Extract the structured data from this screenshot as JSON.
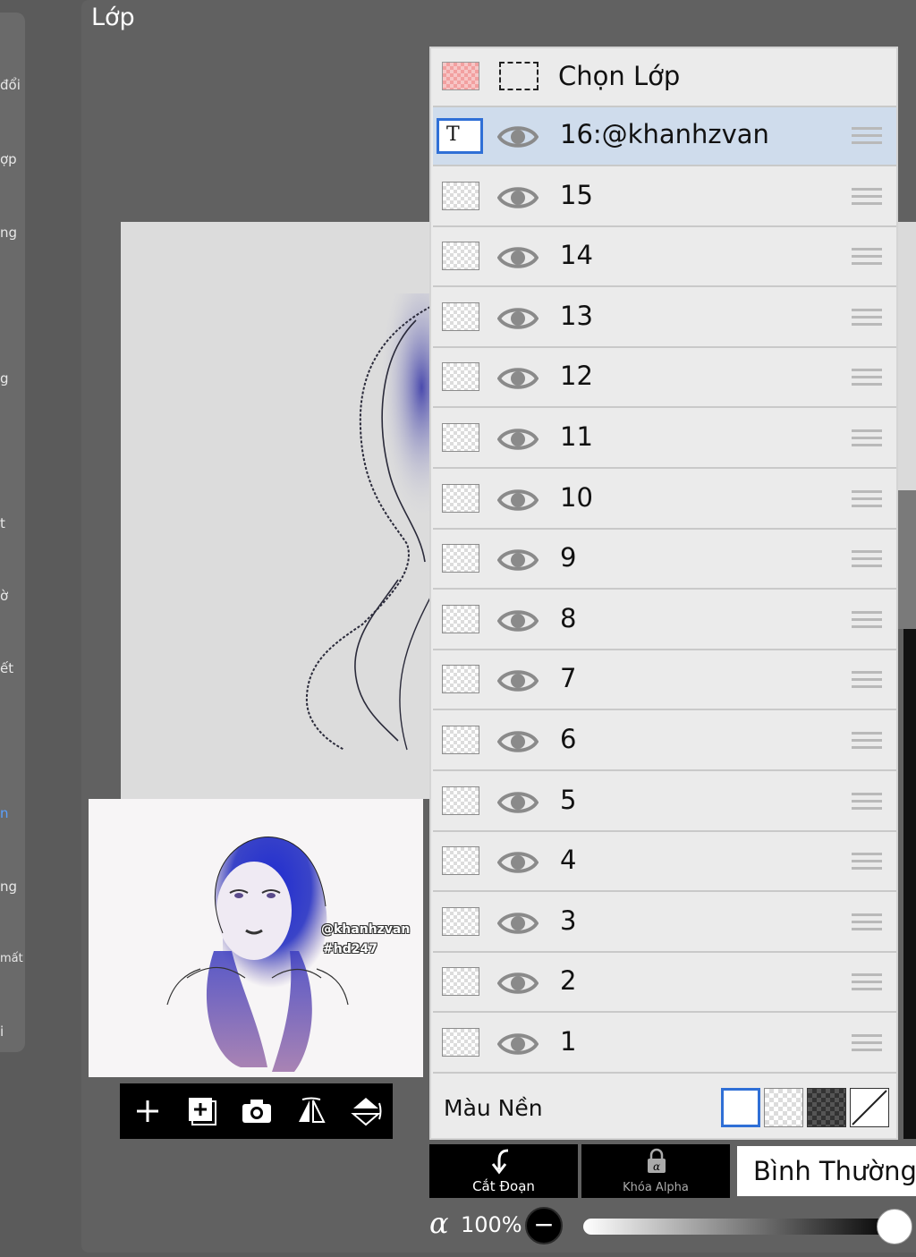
{
  "panel": {
    "title": "Lớp"
  },
  "side_menu": {
    "fragments": [
      "đổi",
      "ợp",
      "ng",
      "g",
      "t",
      "ờ",
      "ết",
      "n",
      "ng",
      "mất",
      "i"
    ]
  },
  "layers": {
    "header": {
      "label": "Chọn Lớp"
    },
    "items": [
      {
        "name": "16:@khanhzvan",
        "selected": true,
        "kind": "text"
      },
      {
        "name": "15"
      },
      {
        "name": "14"
      },
      {
        "name": "13"
      },
      {
        "name": "12"
      },
      {
        "name": "11"
      },
      {
        "name": "10"
      },
      {
        "name": "9"
      },
      {
        "name": "8"
      },
      {
        "name": "7"
      },
      {
        "name": "6"
      },
      {
        "name": "5"
      },
      {
        "name": "4"
      },
      {
        "name": "3"
      },
      {
        "name": "2"
      },
      {
        "name": "1"
      }
    ],
    "background": {
      "label": "Màu Nền",
      "options": [
        "white",
        "transparent",
        "dark-checker",
        "none"
      ],
      "selected": "white"
    }
  },
  "thumbnail": {
    "watermark_1": "@khanhzvan",
    "watermark_2": "#hd247"
  },
  "toolbar": {
    "icons": [
      "plus-icon",
      "add-layer-icon",
      "camera-icon",
      "flip-horizontal-icon",
      "flip-vertical-icon"
    ]
  },
  "actions": {
    "clipping": "Cắt Đoạn",
    "alpha_lock": "Khóa Alpha",
    "blend_mode": "Bình Thường"
  },
  "opacity": {
    "symbol": "α",
    "value_label": "100%",
    "value": 100,
    "minus": "−"
  },
  "colors": {
    "selected_row": "#cfdcec",
    "accent_blue": "#2f6fd6"
  }
}
